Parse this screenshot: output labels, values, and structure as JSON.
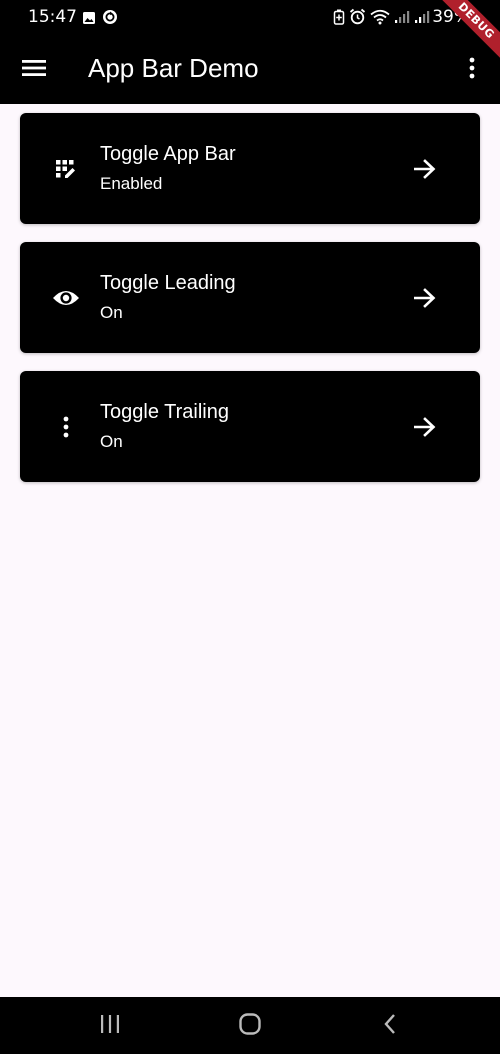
{
  "status_bar": {
    "time": "15:47",
    "battery": "39%",
    "icons_left": [
      "image-icon",
      "sync-icon"
    ],
    "icons_right": [
      "battery-saver-icon",
      "alarm-icon",
      "wifi-icon",
      "signal-icon",
      "signal-icon"
    ]
  },
  "debug_banner": "DEBUG",
  "app_bar": {
    "title": "App Bar Demo",
    "leading_icon": "menu-icon",
    "trailing_icon": "more-vert-icon",
    "background": "#000000"
  },
  "cards": [
    {
      "title": "Toggle App Bar",
      "subtitle": "Enabled",
      "icon": "app-registration-icon",
      "action_icon": "arrow-forward-icon"
    },
    {
      "title": "Toggle Leading",
      "subtitle": "On",
      "icon": "visibility-icon",
      "action_icon": "arrow-forward-icon"
    },
    {
      "title": "Toggle Trailing",
      "subtitle": "On",
      "icon": "more-vert-icon",
      "action_icon": "arrow-forward-icon"
    }
  ],
  "nav_bar": {
    "buttons": [
      "recent-apps-icon",
      "home-icon",
      "back-icon"
    ]
  },
  "colors": {
    "page_background": "#fdf8fd",
    "card_background": "#000000",
    "debug_ribbon": "#b0202c"
  }
}
